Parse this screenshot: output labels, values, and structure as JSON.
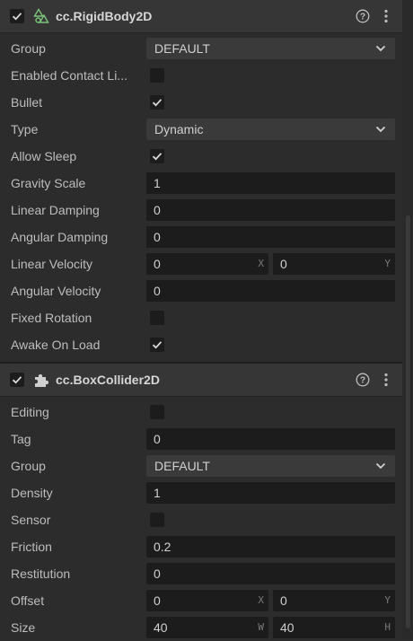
{
  "rigidbody": {
    "title": "cc.RigidBody2D",
    "enabled": true,
    "group": {
      "label": "Group",
      "value": "DEFAULT"
    },
    "enabled_contact_listener": {
      "label": "Enabled Contact Li...",
      "checked": false
    },
    "bullet": {
      "label": "Bullet",
      "checked": true
    },
    "type": {
      "label": "Type",
      "value": "Dynamic"
    },
    "allow_sleep": {
      "label": "Allow Sleep",
      "checked": true
    },
    "gravity_scale": {
      "label": "Gravity Scale",
      "value": "1"
    },
    "linear_damping": {
      "label": "Linear Damping",
      "value": "0"
    },
    "angular_damping": {
      "label": "Angular Damping",
      "value": "0"
    },
    "linear_velocity": {
      "label": "Linear Velocity",
      "x": "0",
      "x_axis": "X",
      "y": "0",
      "y_axis": "Y"
    },
    "angular_velocity": {
      "label": "Angular Velocity",
      "value": "0"
    },
    "fixed_rotation": {
      "label": "Fixed Rotation",
      "checked": false
    },
    "awake_on_load": {
      "label": "Awake On Load",
      "checked": true
    }
  },
  "boxcollider": {
    "title": "cc.BoxCollider2D",
    "enabled": true,
    "editing": {
      "label": "Editing",
      "checked": false
    },
    "tag": {
      "label": "Tag",
      "value": "0"
    },
    "group": {
      "label": "Group",
      "value": "DEFAULT"
    },
    "density": {
      "label": "Density",
      "value": "1"
    },
    "sensor": {
      "label": "Sensor",
      "checked": false
    },
    "friction": {
      "label": "Friction",
      "value": "0.2"
    },
    "restitution": {
      "label": "Restitution",
      "value": "0"
    },
    "offset": {
      "label": "Offset",
      "x": "0",
      "x_axis": "X",
      "y": "0",
      "y_axis": "Y"
    },
    "size": {
      "label": "Size",
      "w": "40",
      "w_axis": "W",
      "h": "40",
      "h_axis": "H"
    }
  },
  "colors": {
    "accent_icon": "#7cc47a",
    "panel_bg": "#2c2c2c",
    "field_bg": "#1c1c1c"
  },
  "icons": [
    "checkmark-icon",
    "rigidbody-icon",
    "puzzle-piece-icon",
    "help-icon",
    "more-vertical-icon",
    "chevron-down-icon"
  ]
}
